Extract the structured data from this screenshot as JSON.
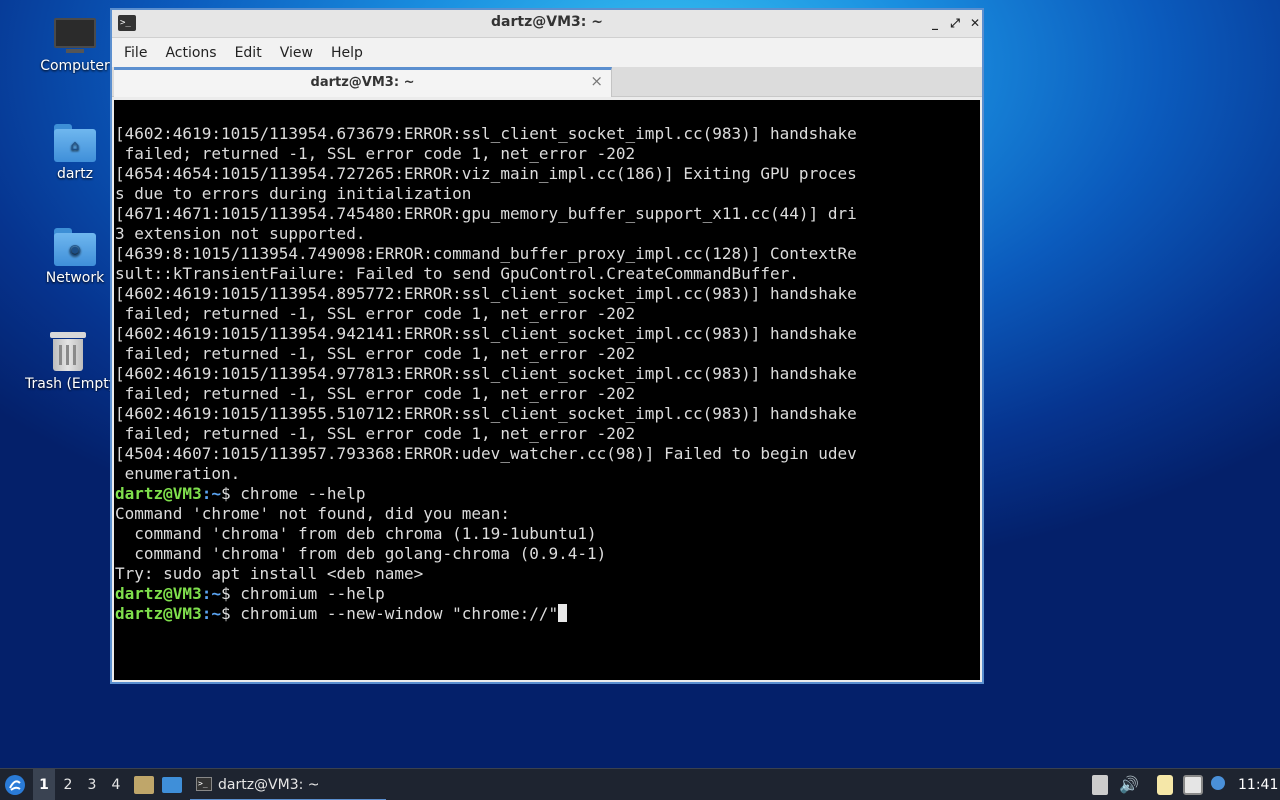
{
  "desktop": {
    "icons": [
      {
        "label": "Computer"
      },
      {
        "label": "dartz"
      },
      {
        "label": "Network"
      },
      {
        "label": "Trash (Empty)"
      }
    ]
  },
  "window": {
    "title": "dartz@VM3: ~",
    "controls": {
      "minimize": "_",
      "maximize": "⤢",
      "close": "✕"
    },
    "menu": [
      "File",
      "Actions",
      "Edit",
      "View",
      "Help"
    ],
    "tab": {
      "label": "dartz@VM3: ~",
      "close": "×"
    }
  },
  "terminal": {
    "prompt_user": "dartz@VM3",
    "prompt_path": ":~",
    "prompt_symbol": "$ ",
    "output_lines": [
      "[4602:4619:1015/113954.673679:ERROR:ssl_client_socket_impl.cc(983)] handshake",
      " failed; returned -1, SSL error code 1, net_error -202",
      "[4654:4654:1015/113954.727265:ERROR:viz_main_impl.cc(186)] Exiting GPU proces",
      "s due to errors during initialization",
      "[4671:4671:1015/113954.745480:ERROR:gpu_memory_buffer_support_x11.cc(44)] dri",
      "3 extension not supported.",
      "[4639:8:1015/113954.749098:ERROR:command_buffer_proxy_impl.cc(128)] ContextRe",
      "sult::kTransientFailure: Failed to send GpuControl.CreateCommandBuffer.",
      "[4602:4619:1015/113954.895772:ERROR:ssl_client_socket_impl.cc(983)] handshake",
      " failed; returned -1, SSL error code 1, net_error -202",
      "[4602:4619:1015/113954.942141:ERROR:ssl_client_socket_impl.cc(983)] handshake",
      " failed; returned -1, SSL error code 1, net_error -202",
      "[4602:4619:1015/113954.977813:ERROR:ssl_client_socket_impl.cc(983)] handshake",
      " failed; returned -1, SSL error code 1, net_error -202",
      "[4602:4619:1015/113955.510712:ERROR:ssl_client_socket_impl.cc(983)] handshake",
      " failed; returned -1, SSL error code 1, net_error -202",
      "[4504:4607:1015/113957.793368:ERROR:udev_watcher.cc(98)] Failed to begin udev",
      " enumeration."
    ],
    "cmd1": "chrome --help",
    "cmd1_output": [
      "Command 'chrome' not found, did you mean:",
      "  command 'chroma' from deb chroma (1.19-1ubuntu1)",
      "  command 'chroma' from deb golang-chroma (0.9.4-1)",
      "Try: sudo apt install <deb name>"
    ],
    "cmd2": "chromium --help",
    "cmd3_current": "chromium --new-window \"chrome://\""
  },
  "taskbar": {
    "workspaces": [
      "1",
      "2",
      "3",
      "4"
    ],
    "window_button": "dartz@VM3: ~",
    "clock": "11:41"
  }
}
